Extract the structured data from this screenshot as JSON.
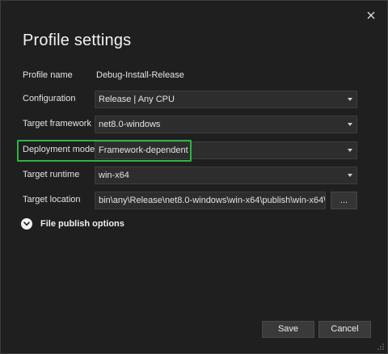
{
  "dialog": {
    "title": "Profile settings",
    "close_icon": "close-icon"
  },
  "fields": {
    "profile_name": {
      "label": "Profile name",
      "value": "Debug-Install-Release"
    },
    "configuration": {
      "label": "Configuration",
      "value": "Release | Any CPU"
    },
    "target_framework": {
      "label": "Target framework",
      "value": "net8.0-windows"
    },
    "deployment_mode": {
      "label": "Deployment mode",
      "value": "Framework-dependent"
    },
    "target_runtime": {
      "label": "Target runtime",
      "value": "win-x64"
    },
    "target_location": {
      "label": "Target location",
      "value": "bin\\any\\Release\\net8.0-windows\\win-x64\\publish\\win-x64\\",
      "browse_label": "..."
    }
  },
  "expander": {
    "label": "File publish options",
    "icon": "chevron-down-icon"
  },
  "buttons": {
    "save": "Save",
    "cancel": "Cancel"
  },
  "colors": {
    "background": "#1f1f1f",
    "field": "#2d2d2d",
    "highlight": "#2db443",
    "text": "#e4e4e4"
  }
}
